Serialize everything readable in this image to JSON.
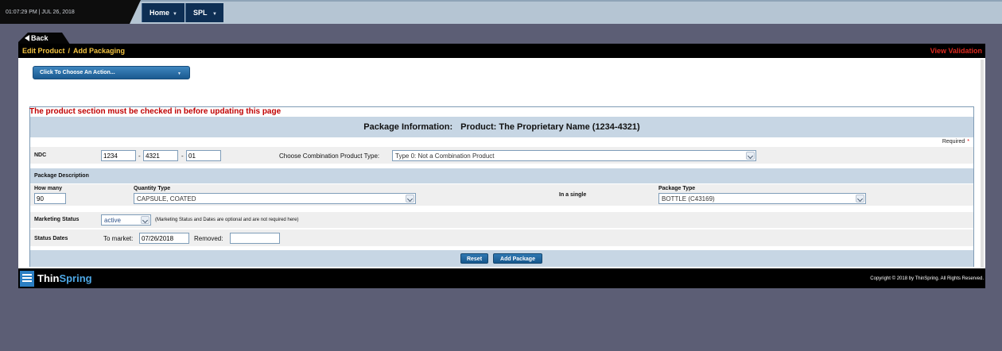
{
  "topbar": {
    "datetime": "01:07:29 PM | JUL 26, 2018",
    "nav": [
      {
        "label": "Home"
      },
      {
        "label": "SPL"
      }
    ]
  },
  "back_label": "Back",
  "breadcrumb": {
    "edit": "Edit Product",
    "separator": "/",
    "current": "Add Packaging"
  },
  "view_validation": "View Validation",
  "action_menu": "Click To Choose An Action...",
  "warning": "The product section must be checked in before updating this page",
  "package_info": {
    "heading": "Package Information:",
    "product": "Product: The Proprietary Name (1234-4321)"
  },
  "required_label": "Required",
  "required_star": "*",
  "ndc": {
    "label": "NDC",
    "part1": "1234",
    "part2": "4321",
    "part3": "01",
    "dash": "-"
  },
  "combination": {
    "label": "Choose Combination Product Type:",
    "value": "Type 0: Not a Combination Product"
  },
  "package_description": {
    "label": "Package Description",
    "how_many_label": "How many",
    "how_many_value": "90",
    "quantity_type_label": "Quantity Type",
    "quantity_type_value": "CAPSULE, COATED",
    "in_a_single": "In a single",
    "package_type_label": "Package Type",
    "package_type_value": "BOTTLE (C43169)"
  },
  "marketing": {
    "status_label": "Marketing Status",
    "status_value": "active",
    "note": "(Marketing Status and Dates are optional and are not required here)",
    "dates_label": "Status Dates",
    "to_market_label": "To market:",
    "to_market_value": "07/26/2018",
    "removed_label": "Removed:",
    "removed_value": ""
  },
  "buttons": {
    "reset": "Reset",
    "add_package": "Add Package"
  },
  "footer": {
    "logo_thin": "Thin",
    "logo_spring": "Spring",
    "copyright": "Copyright © 2018 by ThinSpring. All Rights Reserved."
  }
}
